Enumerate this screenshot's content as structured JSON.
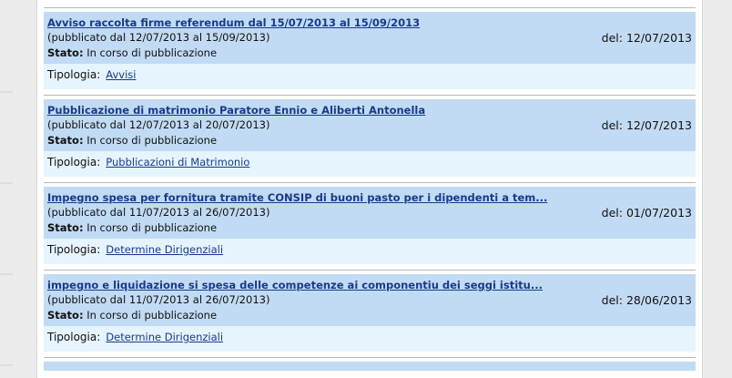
{
  "entries": [
    {
      "title": "Avviso raccolta firme referendum dal 15/07/2013 al 15/09/2013",
      "period": "(pubblicato dal 12/07/2013 al 15/09/2013)",
      "status_label": "Stato:",
      "status_value": "In corso di pubblicazione",
      "date": "del: 12/07/2013",
      "type_label": "Tipologia:",
      "type_value": "Avvisi"
    },
    {
      "title": "Pubblicazione di matrimonio Paratore Ennio e Aliberti Antonella",
      "period": "(pubblicato dal 12/07/2013 al 20/07/2013)",
      "status_label": "Stato:",
      "status_value": "In corso di pubblicazione",
      "date": "del: 12/07/2013",
      "type_label": "Tipologia:",
      "type_value": "Pubblicazioni di Matrimonio"
    },
    {
      "title": "Impegno spesa per fornitura tramite CONSIP di buoni pasto per i dipendenti a tem...",
      "period": "(pubblicato dal 11/07/2013 al 26/07/2013)",
      "status_label": "Stato:",
      "status_value": "In corso di pubblicazione",
      "date": "del: 01/07/2013",
      "type_label": "Tipologia:",
      "type_value": "Determine Dirigenziali"
    },
    {
      "title": "impegno e liquidazione si spesa delle competenze ai componentiu dei seggi istitu...",
      "period": "(pubblicato dal 11/07/2013 al 26/07/2013)",
      "status_label": "Stato:",
      "status_value": "In corso di pubblicazione",
      "date": "del: 28/06/2013",
      "type_label": "Tipologia:",
      "type_value": "Determine Dirigenziali"
    }
  ]
}
